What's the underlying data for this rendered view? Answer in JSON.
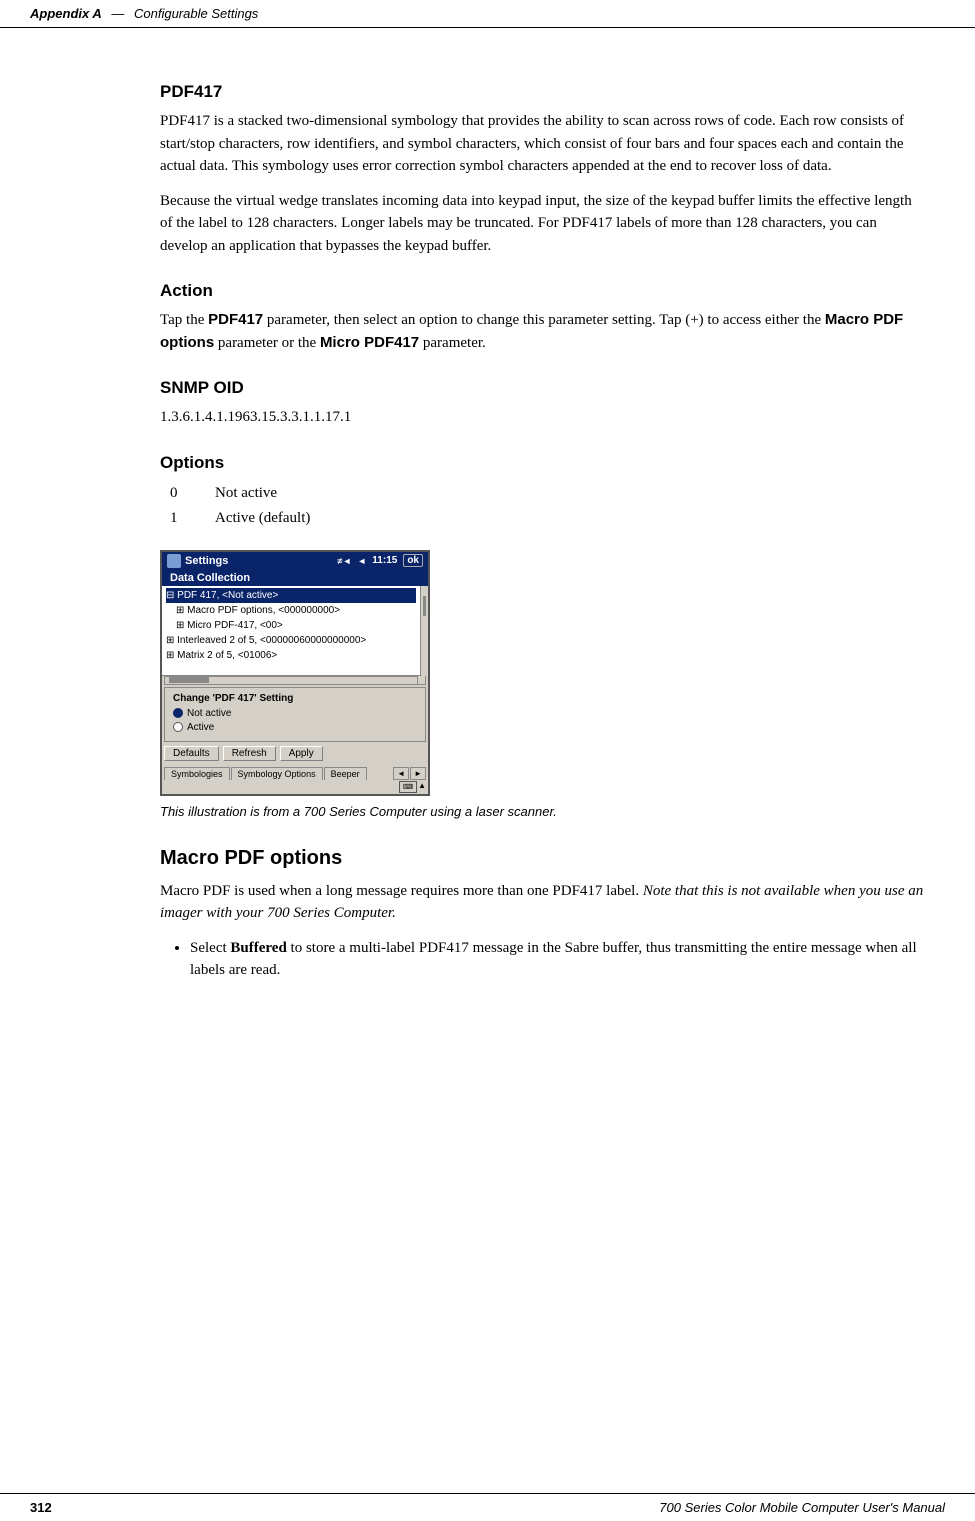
{
  "header": {
    "left": "Appendix A",
    "dash": "—",
    "right": "Configurable Settings"
  },
  "footer": {
    "left": "312",
    "right": "700 Series Color Mobile Computer User's Manual"
  },
  "sections": {
    "pdf417": {
      "title": "PDF417",
      "para1": "PDF417 is a stacked two-dimensional symbology that provides the ability to scan across rows of code. Each row consists of start/stop characters, row identifiers, and symbol characters, which consist of four bars and four spaces each and contain the actual data. This symbology uses error correction symbol characters appended at the end to recover loss of data.",
      "para2": "Because the virtual wedge translates incoming data into keypad input, the size of the keypad buffer limits the effective length of the label to 128 characters. Longer labels may be truncated. For PDF417 labels of more than 128 characters, you can develop an application that bypasses the keypad buffer."
    },
    "action": {
      "title": "Action",
      "text_before": "Tap the ",
      "bold1": "PDF417",
      "text_mid1": " parameter, then select an option to change this parameter setting. Tap (+) to access either the ",
      "bold2": "Macro PDF options",
      "text_mid2": " parameter or the ",
      "bold3": "Micro PDF417",
      "text_end": " parameter."
    },
    "snmp": {
      "title": "SNMP OID",
      "value": "1.3.6.1.4.1.1963.15.3.3.1.1.17.1"
    },
    "options": {
      "title": "Options",
      "items": [
        {
          "value": "0",
          "description": "Not active"
        },
        {
          "value": "1",
          "description": "Active (default)"
        }
      ]
    },
    "screenshot": {
      "titlebar": {
        "icon_label": "settings-icon",
        "title": "Settings",
        "signal": "≠◄",
        "volume": "◄",
        "time": "11:15",
        "ok": "ok"
      },
      "tab_header": "Data Collection",
      "tree_items": [
        {
          "text": "⊟ PDF 417, <Not active>",
          "indent": 0,
          "selected": true
        },
        {
          "text": "⊞ Macro PDF options, <000000000>",
          "indent": 1,
          "selected": false
        },
        {
          "text": "⊞ Micro PDF-417, <00>",
          "indent": 1,
          "selected": false
        },
        {
          "text": "⊞ Interleaved 2 of 5, <00000060000000000>",
          "indent": 0,
          "selected": false
        },
        {
          "text": "⊞ Matrix 2 of 5, <01006>",
          "indent": 0,
          "selected": false
        }
      ],
      "settings_panel": {
        "title": "Change 'PDF 417' Setting",
        "options": [
          {
            "label": "Not active",
            "selected": true
          },
          {
            "label": "Active",
            "selected": false
          }
        ]
      },
      "buttons": {
        "defaults": "Defaults",
        "refresh": "Refresh",
        "apply": "Apply"
      },
      "tabs": [
        {
          "label": "Symbologies",
          "active": false
        },
        {
          "label": "Symbology Options",
          "active": false
        },
        {
          "label": "Beeper",
          "active": false
        }
      ]
    },
    "caption": "This illustration is  from a 700 Series Computer using a laser scanner.",
    "macro_pdf": {
      "title": "Macro PDF options",
      "para1_before": "Macro PDF is used when a long message requires more than one PDF417 label. ",
      "para1_italic": "Note that this is not available when you use an imager with your 700 Series Computer.",
      "bullets": [
        {
          "before": "Select ",
          "bold": "Buffered",
          "after": " to store a multi-label PDF417 message in the Sabre buffer, thus transmitting the entire message when all labels are read."
        }
      ]
    }
  }
}
